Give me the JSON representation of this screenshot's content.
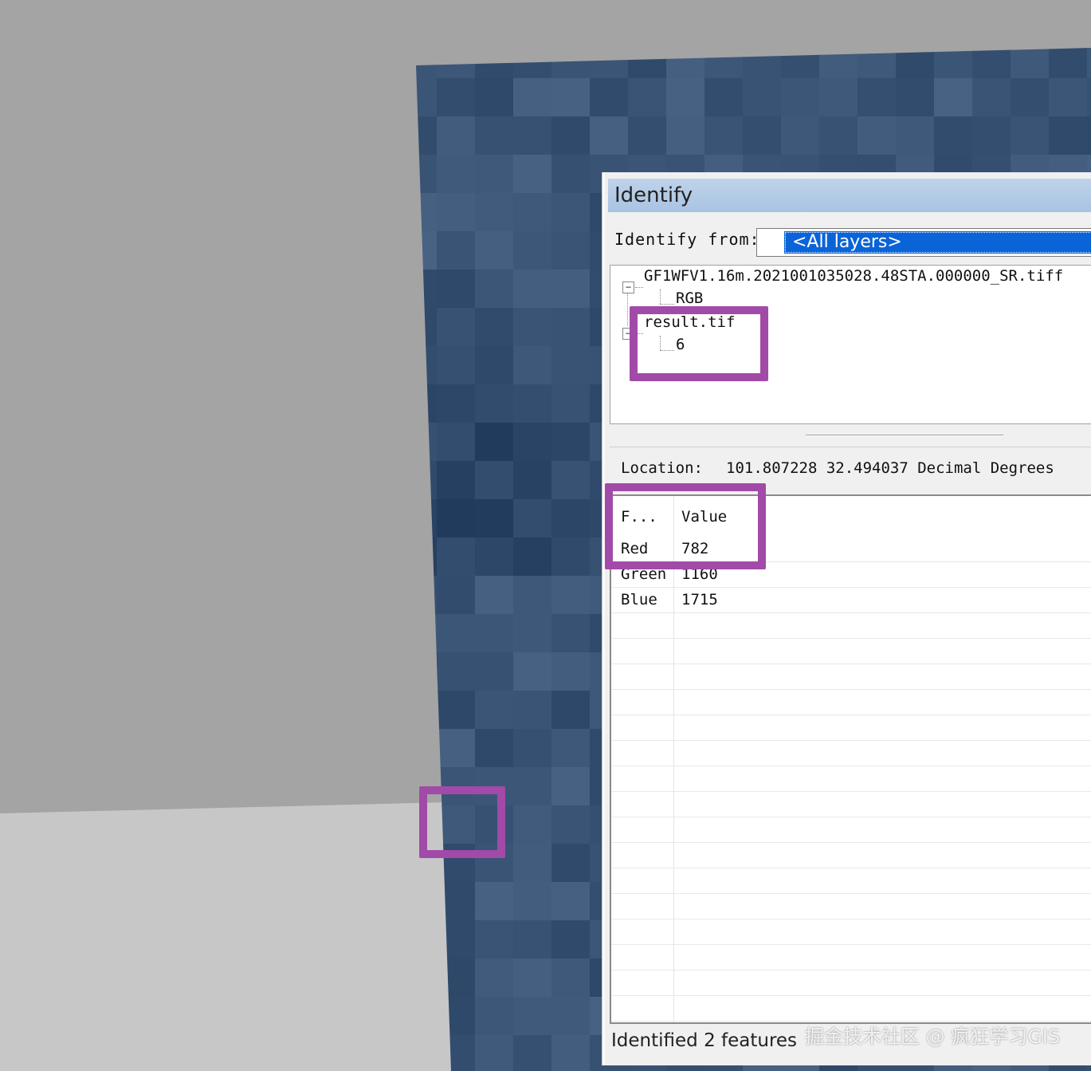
{
  "colors": {
    "highlight": "#a24aa8",
    "selection": "#0a64d8",
    "titlebar": "#a9c3e3",
    "raster_base": "#3b5573",
    "background_gray": "#a4a4a4",
    "background_light": "#c7c7c7"
  },
  "window": {
    "title": "Identify",
    "identify_from_label": "Identify from:",
    "identify_from_value": "<All layers>",
    "tree": {
      "layers": [
        {
          "name": "GF1WFV1.16m.2021001035028.48STA.000000_SR.tiff",
          "child": "RGB"
        },
        {
          "name": "result.tif",
          "child": "6"
        }
      ]
    },
    "location_label": "Location:",
    "location_value": "101.807228   32.494037 Decimal Degrees",
    "grid": {
      "headers": [
        "F...",
        "Value"
      ],
      "rows": [
        [
          "Red",
          "782"
        ],
        [
          "Green",
          "1160"
        ],
        [
          "Blue",
          "1715"
        ]
      ]
    },
    "status": "Identified 2 features"
  },
  "watermark": "掘金技术社区 @ 疯狂学习GIS"
}
